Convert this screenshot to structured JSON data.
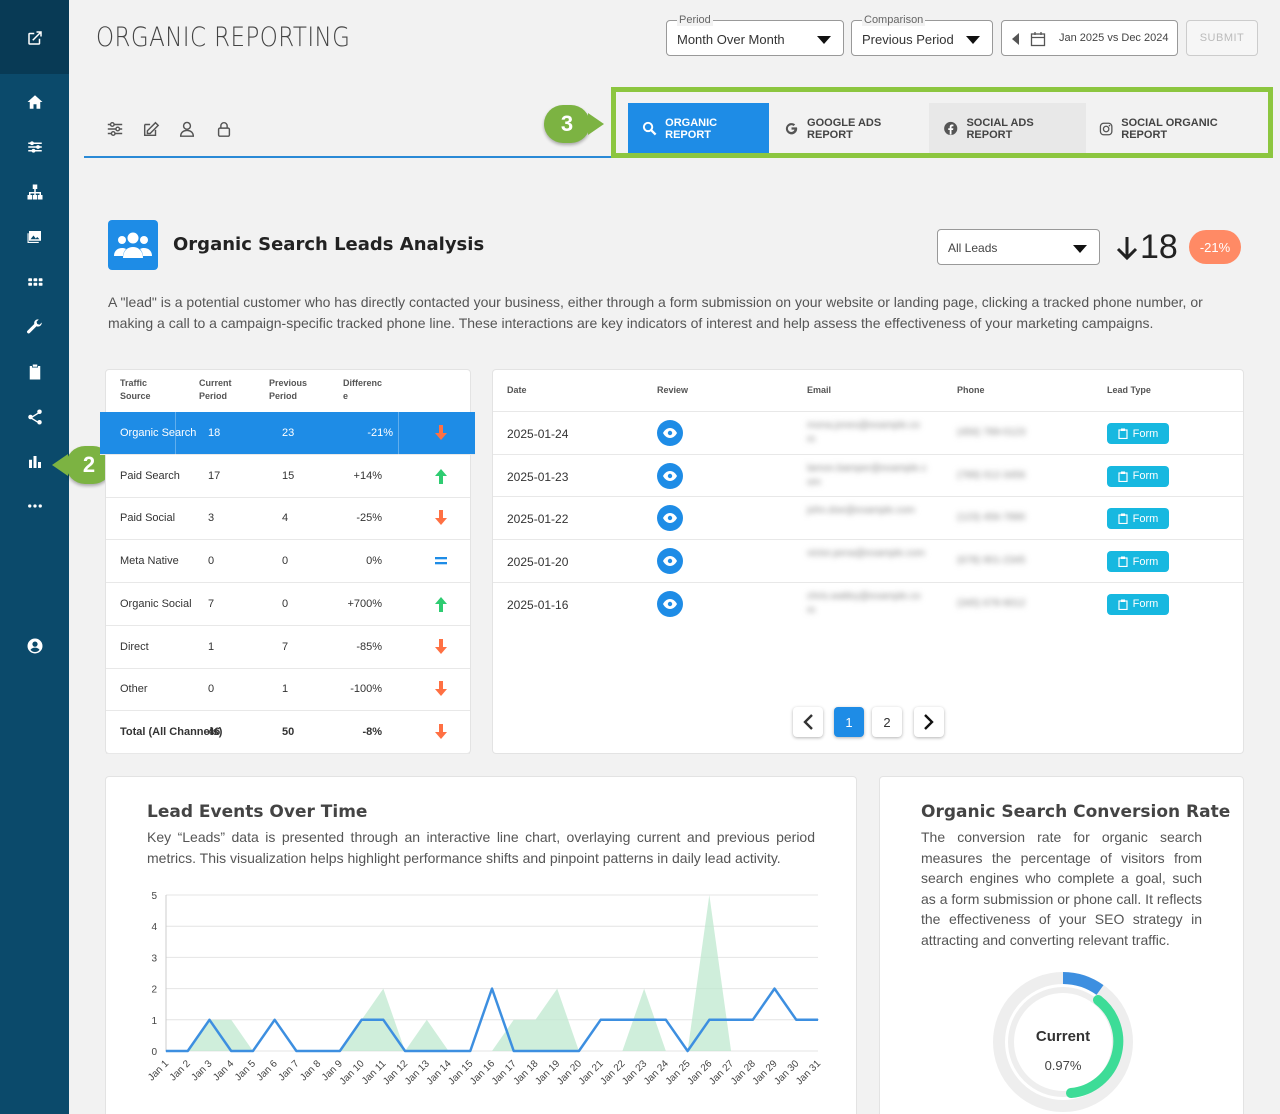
{
  "app": {
    "title": "ORGANIC REPORTING"
  },
  "filters": {
    "period_label": "Period",
    "period_value": "Month Over Month",
    "comparison_label": "Comparison",
    "comparison_value": "Previous Period",
    "date_range": "Jan 2025 vs Dec 2024",
    "submit": "SUBMIT"
  },
  "tabs": [
    {
      "label": "ORGANIC REPORT",
      "icon": "search-icon"
    },
    {
      "label": "GOOGLE ADS REPORT",
      "icon": "google-icon"
    },
    {
      "label": "SOCIAL ADS REPORT",
      "icon": "facebook-icon"
    },
    {
      "label": "SOCIAL ORGANIC REPORT",
      "icon": "instagram-icon"
    }
  ],
  "callouts": {
    "sidebar": "2",
    "tabs": "3"
  },
  "leads": {
    "title": "Organic Search Leads Analysis",
    "description": "A \"lead\" is a potential customer who has directly contacted your business, either through a form submission on your website or landing page, clicking a tracked phone number, or making a call to a campaign-specific tracked phone line. These interactions are key indicators of interest and help assess the effectiveness of your marketing campaigns.",
    "filter_value": "All Leads",
    "total": "18",
    "change": "-21%"
  },
  "traffic_table": {
    "headers": [
      "Traffic Source",
      "Current Period",
      "Previous Period",
      "Difference"
    ],
    "rows": [
      {
        "source": "Organic Search",
        "current": "18",
        "previous": "23",
        "diff": "-21%",
        "trend": "down"
      },
      {
        "source": "Paid Search",
        "current": "17",
        "previous": "15",
        "diff": "+14%",
        "trend": "up"
      },
      {
        "source": "Paid Social",
        "current": "3",
        "previous": "4",
        "diff": "-25%",
        "trend": "down"
      },
      {
        "source": "Meta Native",
        "current": "0",
        "previous": "0",
        "diff": "0%",
        "trend": "equal"
      },
      {
        "source": "Organic Social",
        "current": "7",
        "previous": "0",
        "diff": "+700%",
        "trend": "up"
      },
      {
        "source": "Direct",
        "current": "1",
        "previous": "7",
        "diff": "-85%",
        "trend": "down"
      },
      {
        "source": "Other",
        "current": "0",
        "previous": "1",
        "diff": "-100%",
        "trend": "down"
      },
      {
        "source": "Total (All Channels)",
        "current": "46",
        "previous": "50",
        "diff": "-8%",
        "trend": "down"
      }
    ]
  },
  "leads_table": {
    "headers": [
      "Date",
      "Review",
      "Email",
      "Phone",
      "Lead Type"
    ],
    "rows": [
      {
        "date": "2025-01-24",
        "email": "mona.jones@example.com",
        "phone": "(456) 789-0123",
        "type": "Form"
      },
      {
        "date": "2025-01-23",
        "email": "lamon.bamper@example.com",
        "phone": "(789) 012-3456",
        "type": "Form"
      },
      {
        "date": "2025-01-22",
        "email": "john.doe@example.com",
        "phone": "(123) 456-7890",
        "type": "Form"
      },
      {
        "date": "2025-01-20",
        "email": "victor.pena@example.com",
        "phone": "(678) 901-2345",
        "type": "Form"
      },
      {
        "date": "2025-01-16",
        "email": "chris.watley@example.com",
        "phone": "(345) 678-9012",
        "type": "Form"
      }
    ],
    "pages": [
      "1",
      "2"
    ],
    "current_page": "1"
  },
  "lead_events": {
    "title": "Lead Events Over Time",
    "description": "Key “Leads” data is presented through an interactive line chart, overlaying current and previous period metrics. This visualization helps highlight performance shifts and pinpoint patterns in daily lead activity."
  },
  "chart_data": {
    "type": "line",
    "x": [
      "Jan 1",
      "Jan 2",
      "Jan 3",
      "Jan 4",
      "Jan 5",
      "Jan 6",
      "Jan 7",
      "Jan 8",
      "Jan 9",
      "Jan 10",
      "Jan 11",
      "Jan 12",
      "Jan 13",
      "Jan 14",
      "Jan 15",
      "Jan 16",
      "Jan 17",
      "Jan 18",
      "Jan 19",
      "Jan 20",
      "Jan 21",
      "Jan 22",
      "Jan 23",
      "Jan 24",
      "Jan 25",
      "Jan 26",
      "Jan 27",
      "Jan 28",
      "Jan 29",
      "Jan 30",
      "Jan 31"
    ],
    "series": [
      {
        "values": [
          0,
          0,
          1,
          0,
          0,
          1,
          0,
          0,
          0,
          1,
          1,
          0,
          0,
          0,
          0,
          2,
          0,
          0,
          0,
          0,
          1,
          1,
          1,
          1,
          0,
          1,
          1,
          1,
          2,
          1,
          1
        ],
        "color": "#3d8fe0",
        "style": "line"
      },
      {
        "values": [
          0,
          0,
          1,
          1,
          0,
          0,
          0,
          0,
          0,
          1,
          2,
          0,
          1,
          0,
          0,
          0,
          1,
          1,
          2,
          0,
          0,
          0,
          2,
          0,
          0,
          5,
          0,
          0,
          0,
          0,
          0
        ],
        "color": "#bfe8cf",
        "style": "area"
      }
    ],
    "ylim": [
      0,
      5
    ],
    "yticks": [
      "0",
      "1",
      "2",
      "3",
      "4",
      "5"
    ],
    "grid": true
  },
  "conversion": {
    "title": "Organic Search Conversion Rate",
    "description": "The conversion rate for organic search measures the percentage of visitors from search engines who complete a goal, such as a form submission or phone call. It reflects the effectiveness of your SEO strategy in attracting and converting relevant traffic.",
    "gauge_label": "Current",
    "gauge_value": "0.97%"
  }
}
